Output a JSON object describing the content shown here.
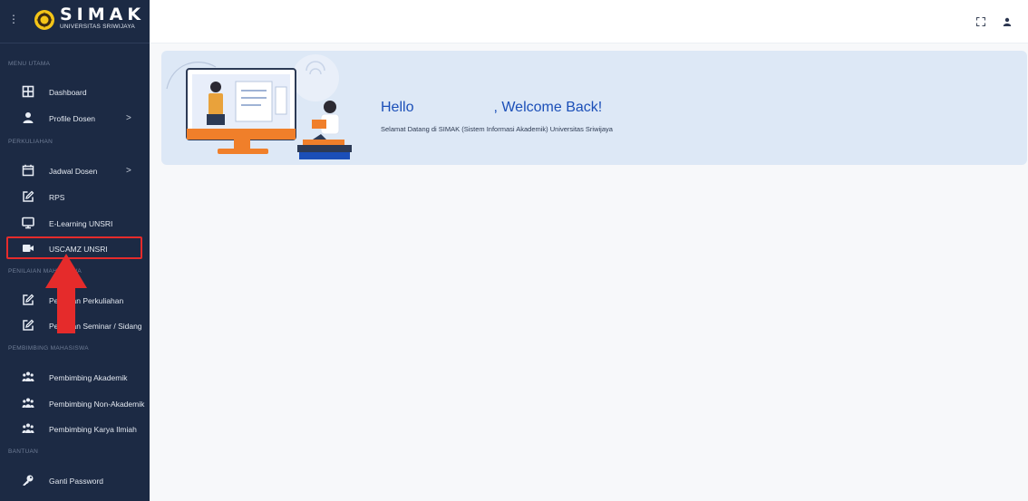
{
  "brand": {
    "title": "SIMAK",
    "subtitle": "UNIVERSITAS SRIWIJAYA",
    "menu_toggle": "⋮",
    "logo_icon": "university-logo-icon"
  },
  "sidebar": {
    "sections": [
      {
        "label": "MENU UTAMA"
      },
      {
        "label": "PERKULIAHAN"
      },
      {
        "label": "PENILAIAN MAHASISWA"
      },
      {
        "label": "PEMBIMBING MAHASISWA"
      },
      {
        "label": "BANTUAN"
      }
    ],
    "items": [
      {
        "label": "Dashboard",
        "icon": "grid-icon"
      },
      {
        "label": "Profile Dosen",
        "icon": "user-icon",
        "chevron": ">"
      },
      {
        "label": "Jadwal Dosen",
        "icon": "calendar-icon",
        "chevron": ">"
      },
      {
        "label": "RPS",
        "icon": "edit-icon"
      },
      {
        "label": "E-Learning UNSRI",
        "icon": "monitor-icon"
      },
      {
        "label": "USCAMZ UNSRI",
        "icon": "video-icon"
      },
      {
        "label": "Penilaian Perkuliahan",
        "icon": "edit-icon"
      },
      {
        "label": "Penilaian Seminar / Sidang",
        "icon": "edit-icon"
      },
      {
        "label": "Pembimbing Akademik",
        "icon": "users-icon"
      },
      {
        "label": "Pembimbing Non-Akademik",
        "icon": "users-icon"
      },
      {
        "label": "Pembimbing Karya Ilmiah",
        "icon": "users-icon"
      },
      {
        "label": "Ganti Password",
        "icon": "key-icon"
      }
    ]
  },
  "topbar": {
    "fullscreen_icon": "fullscreen-icon",
    "profile_icon": "user-profile-icon"
  },
  "banner": {
    "greeting_prefix": "Hello",
    "greeting_suffix": ", Welcome Back!",
    "welcome_text": "Selamat Datang di SIMAK (Sistem Informasi Akademik) Universitas Sriwijaya"
  },
  "colors": {
    "sidebar_bg": "#1c2a44",
    "banner_bg": "#dde8f6",
    "accent_blue": "#1b4fb8",
    "highlight_red": "#e52b2b"
  }
}
